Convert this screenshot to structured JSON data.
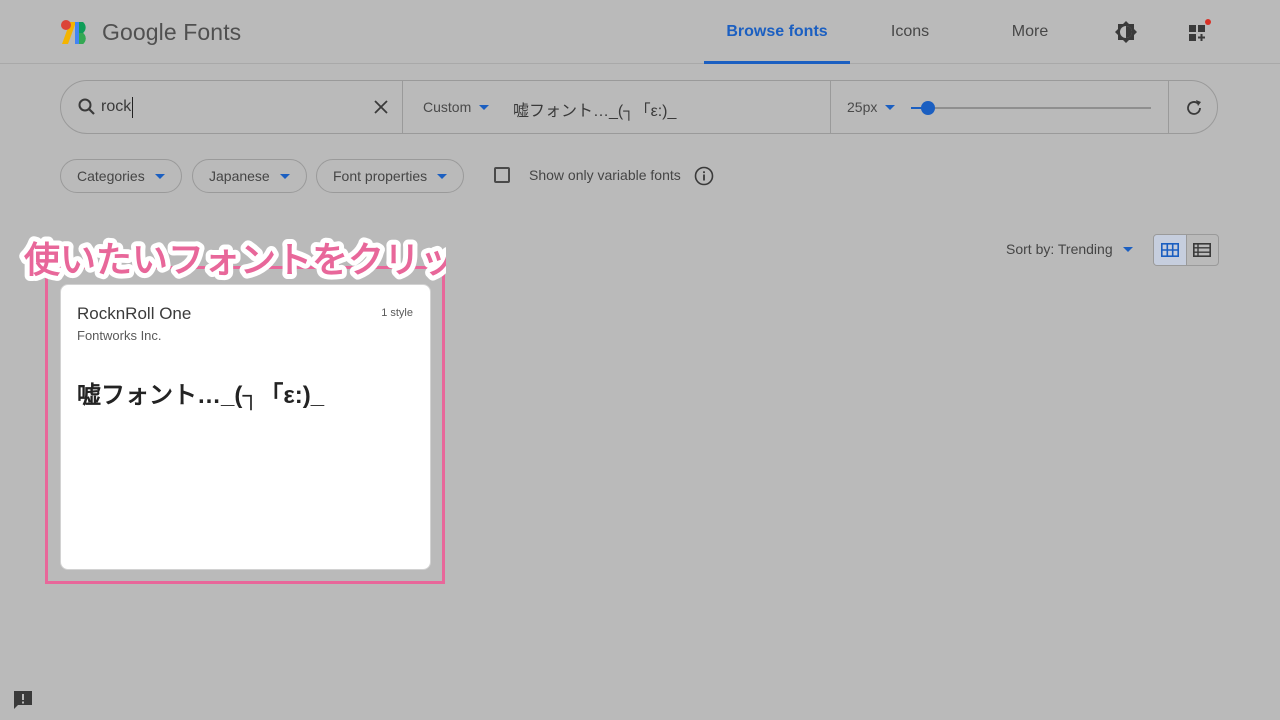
{
  "brand": {
    "name": "Google Fonts"
  },
  "nav": {
    "tabs": [
      {
        "label": "Browse fonts",
        "active": true
      },
      {
        "label": "Icons",
        "active": false
      },
      {
        "label": "More",
        "active": false
      }
    ],
    "theme_icon": "brightness-icon",
    "apps_icon": "add-widget-icon"
  },
  "search": {
    "value": "rock",
    "preview_mode": "Custom",
    "preview_text": "嘘フォント…_(┐「ε:)_",
    "font_size": "25px",
    "font_size_fraction": 0.07
  },
  "filters": {
    "chips": [
      "Categories",
      "Japanese",
      "Font properties"
    ],
    "variable_label": "Show only variable fonts",
    "variable_checked": false
  },
  "sort": {
    "label": "Sort by: Trending"
  },
  "annotation": {
    "text": "使いたいフォントをクリック",
    "color": "#e8679a"
  },
  "results": [
    {
      "name": "RocknRoll One",
      "styles": "1 style",
      "foundry": "Fontworks Inc.",
      "preview": "嘘フォント…_(┐「ε:)_"
    }
  ],
  "colors": {
    "accent": "#1b5fc1",
    "background": "#bababa",
    "highlight": "#e8679a"
  }
}
